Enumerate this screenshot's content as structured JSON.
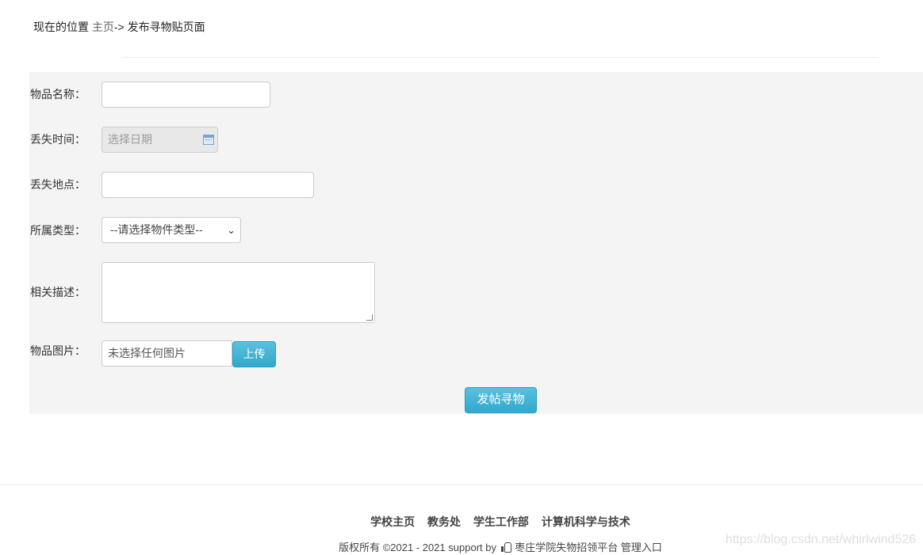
{
  "breadcrumb": {
    "prefix": "现在的位置",
    "home": "主页",
    "separator": "->",
    "current": "发布寻物贴页面"
  },
  "form": {
    "item_name_label": "物品名称：",
    "item_name_value": "",
    "lost_time_label": "丢失时间：",
    "lost_time_placeholder": "选择日期",
    "lost_place_label": "丢失地点：",
    "lost_place_value": "",
    "category_label": "所属类型：",
    "category_selected": "--请选择物件类型--",
    "description_label": "相关描述：",
    "description_value": "",
    "image_label": "物品图片：",
    "image_status": "未选择任何图片",
    "upload_label": "上传",
    "submit_label": "发帖寻物"
  },
  "footer": {
    "links": [
      "学校主页",
      "教务处",
      "学生工作部",
      "计算机科学与技术"
    ],
    "copyright_prefix": "版权所有 ©2021 - 2021 support by",
    "copyright_suffix": "枣庄学院失物招领平台 管理入口"
  },
  "watermark": "https://blog.csdn.net/whirlwind526",
  "colors": {
    "button_blue": "#31a8cc",
    "panel_bg": "#f4f4f4"
  },
  "icons": [
    "calendar-icon",
    "chevron-down-icon",
    "thumbs-up-icon"
  ]
}
